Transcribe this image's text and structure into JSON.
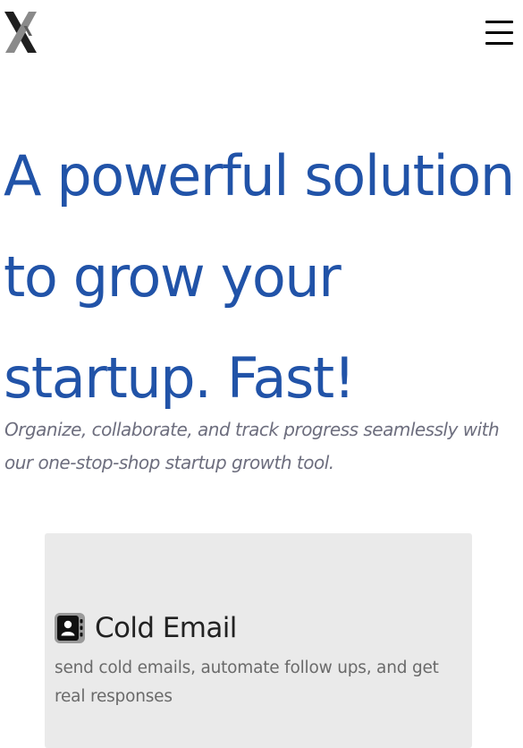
{
  "header": {
    "logo_icon": "x-logo-icon",
    "menu_icon": "hamburger-menu-icon"
  },
  "hero": {
    "title": "A powerful solution to grow your startup. Fast!",
    "subtitle": "Organize, collaborate, and track progress seamlessly with our one-stop-shop startup growth tool."
  },
  "features": [
    {
      "icon": "address-book-icon",
      "title": "Cold Email",
      "description": "send cold emails, automate follow ups, and get real responses"
    }
  ],
  "colors": {
    "heading": "#2153a8",
    "subtitle": "#6d6e7e",
    "card_background": "#eaeaea",
    "card_title": "#222222",
    "card_text": "#6a6a6a"
  }
}
